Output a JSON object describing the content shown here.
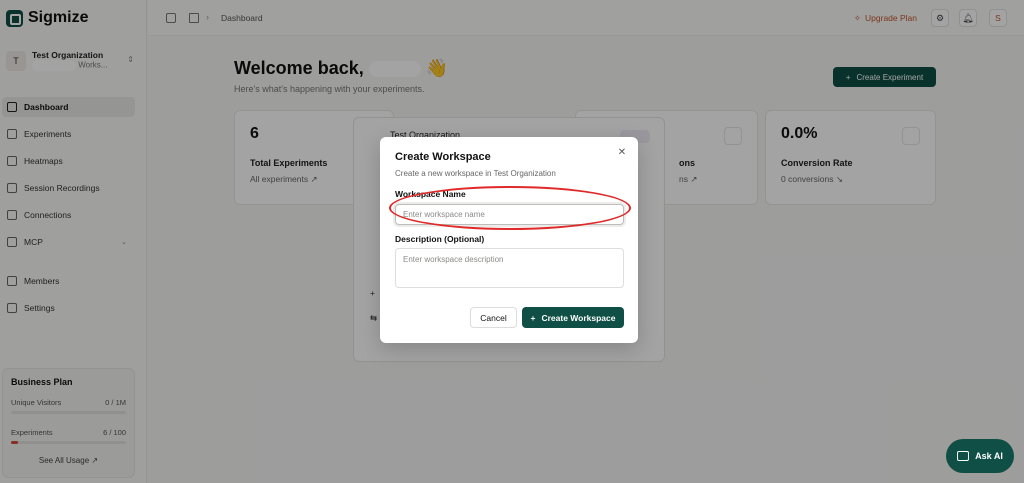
{
  "brand": {
    "name": "Sigmize"
  },
  "org_switcher": {
    "avatar": "T",
    "name": "Test Organization",
    "sub": "Works..."
  },
  "sidebar": {
    "items": [
      {
        "label": "Dashboard",
        "icon": "grid-icon",
        "active": true
      },
      {
        "label": "Experiments",
        "icon": "flask-icon"
      },
      {
        "label": "Heatmaps",
        "icon": "flame-icon"
      },
      {
        "label": "Session Recordings",
        "icon": "video-icon"
      },
      {
        "label": "Connections",
        "icon": "plug-icon"
      },
      {
        "label": "MCP",
        "icon": "server-icon"
      },
      {
        "label": "Members",
        "icon": "users-icon"
      },
      {
        "label": "Settings",
        "icon": "gear-icon"
      }
    ]
  },
  "plan": {
    "title": "Business Plan",
    "visitors_label": "Unique Visitors",
    "visitors_value": "0 / 1M",
    "experiments_label": "Experiments",
    "experiments_value": "6 / 100",
    "experiments_fraction": 0.06,
    "link": "See All Usage"
  },
  "topbar": {
    "breadcrumb": "Dashboard",
    "upgrade": "Upgrade Plan",
    "user_initial": "S"
  },
  "main": {
    "welcome": "Welcome back,",
    "subtitle": "Here's what's happening with your experiments.",
    "create_experiment": "Create Experiment"
  },
  "stats": [
    {
      "value": "6",
      "label": "Total Experiments",
      "sub": "All experiments"
    },
    {
      "value": "",
      "label": "ons",
      "sub": "ns"
    },
    {
      "value": "0.0%",
      "label": "Conversion Rate",
      "sub": "0 conversions"
    }
  ],
  "bg_panel": {
    "org": "Test Organization",
    "tag": "nt"
  },
  "modal": {
    "title": "Create Workspace",
    "subtitle": "Create a new workspace in Test Organization",
    "name_label": "Workspace Name",
    "name_placeholder": "Enter workspace name",
    "desc_label": "Description (Optional)",
    "desc_placeholder": "Enter workspace description",
    "cancel": "Cancel",
    "create": "Create Workspace"
  },
  "ask_ai": "Ask AI",
  "colors": {
    "brand": "#0f4f45",
    "highlight": "#e02a2a",
    "upgrade": "#c2562a"
  }
}
